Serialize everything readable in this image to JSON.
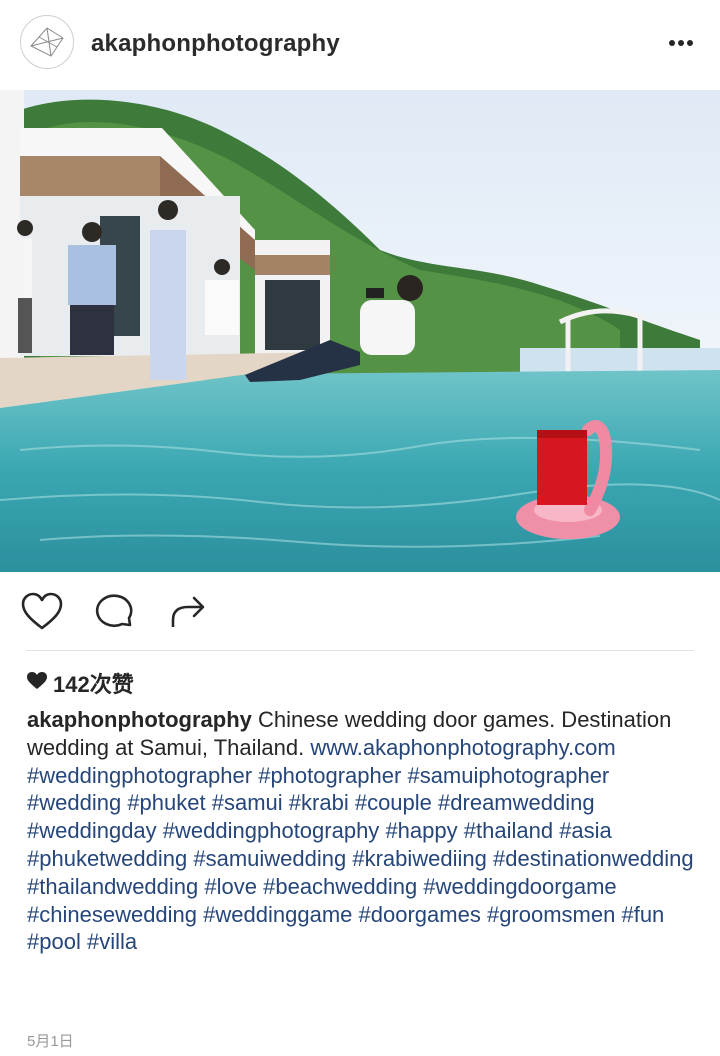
{
  "header": {
    "username": "akaphonphotography",
    "more_icon": "more-horizontal-icon"
  },
  "photo": {
    "description_icon": "post-photo"
  },
  "actions": {
    "like_icon": "heart-outline-icon",
    "comment_icon": "comment-bubble-icon",
    "share_icon": "share-arrow-icon"
  },
  "likes": {
    "count_text": "142次赞"
  },
  "caption": {
    "author": "akaphonphotography",
    "text": "Chinese wedding door games. Destination wedding at Samui, Thailand.",
    "link": "www.akaphonphotography.com",
    "hashtags": [
      "#weddingphotographer",
      "#photographer",
      "#samuiphotographer",
      "#wedding",
      "#phuket",
      "#samui",
      "#krabi",
      "#couple",
      "#dreamwedding",
      "#weddingday",
      "#weddingphotography",
      "#happy",
      "#thailand",
      "#asia",
      "#phuketwedding",
      "#samuiwedding",
      "#krabiwediing",
      "#destinationwedding",
      "#thailandwedding",
      "#love",
      "#beachwedding",
      "#weddingdoorgame",
      "#chinesewedding",
      "#weddinggame",
      "#doorgames",
      "#groomsmen",
      "#fun",
      "#pool",
      "#villa"
    ]
  },
  "date": "5月1日",
  "colors": {
    "hashtag": "#26467a",
    "text": "#262626",
    "muted": "#999999"
  }
}
